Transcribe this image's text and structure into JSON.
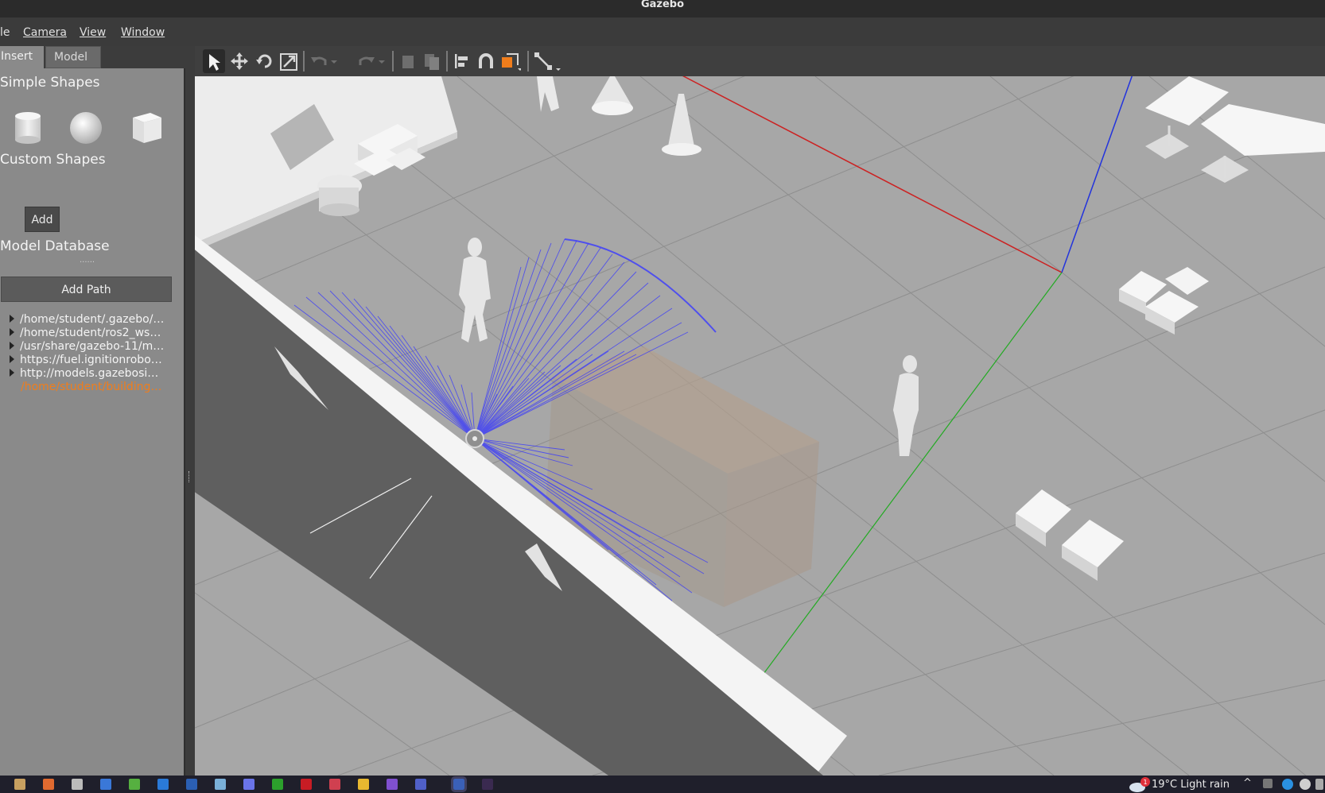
{
  "window": {
    "title": "Gazebo"
  },
  "menu": [
    {
      "label": "le"
    },
    {
      "label": "Camera"
    },
    {
      "label": "View"
    },
    {
      "label": "Window"
    }
  ],
  "tabs": {
    "insert": "Insert",
    "model": "Model"
  },
  "simple_shapes": {
    "title": "Simple Shapes",
    "items": [
      "cylinder-icon",
      "sphere-icon",
      "box-icon"
    ]
  },
  "custom_shapes": {
    "title": "Custom Shapes",
    "add_label": "Add"
  },
  "splitter": "......",
  "model_database": {
    "title": "Model Database",
    "add_path_label": "Add Path",
    "paths": [
      "/home/student/.gazebo/…",
      "/home/student/ros2_ws…",
      "/usr/share/gazebo-11/m…",
      "https://fuel.ignitionrobo…",
      "http://models.gazebosi…"
    ],
    "active_path": "/home/student/building…"
  },
  "toolbar": {
    "tools": [
      "select-icon",
      "translate-icon",
      "rotate-icon",
      "scale-icon",
      "undo-icon",
      "redo-icon",
      "copy-icon",
      "paste-icon",
      "align-icon",
      "snap-icon",
      "view-angle-icon",
      "measure-icon"
    ]
  },
  "taskbar": {
    "weather_text": "19°C  Light rain",
    "notification_count": "1"
  },
  "colors": {
    "accent_orange": "#f07d1c",
    "laser_blue": "#2a2aff",
    "x_axis": "#cc2222",
    "y_axis": "#22aa22",
    "z_axis": "#2233dd"
  }
}
